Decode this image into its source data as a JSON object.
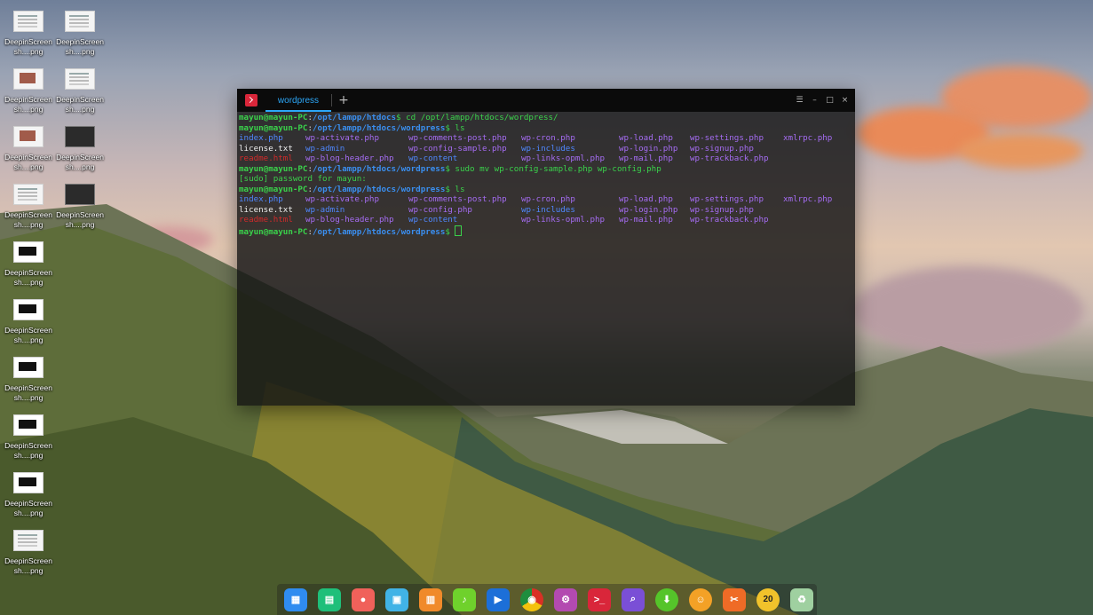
{
  "desktop": {
    "icons": [
      {
        "label": "DeepinScreensh....png",
        "thumb": "doc"
      },
      {
        "label": "DeepinScreensh....png",
        "thumb": "doc"
      },
      {
        "label": "DeepinScreensh....png",
        "thumb": "img"
      },
      {
        "label": "DeepinScreensh....png",
        "thumb": "doc"
      },
      {
        "label": "DeepinScreensh....png",
        "thumb": "img"
      },
      {
        "label": "DeepinScreensh....png",
        "thumb": "dark"
      },
      {
        "label": "DeepinScreensh....png",
        "thumb": "doc"
      },
      {
        "label": "DeepinScreensh....png",
        "thumb": "dark"
      },
      {
        "label": "DeepinScreensh....png",
        "thumb": "bw"
      },
      {
        "label": "DeepinScreensh....png",
        "thumb": "bw"
      },
      {
        "label": "DeepinScreensh....png",
        "thumb": "bw"
      },
      {
        "label": "DeepinScreensh....png",
        "thumb": "bw"
      },
      {
        "label": "DeepinScreensh....png",
        "thumb": "bw"
      },
      {
        "label": "DeepinScreensh....png",
        "thumb": "doc"
      }
    ]
  },
  "terminal": {
    "tab_label": "wordpress",
    "add_tab_icon": "plus-icon",
    "window_buttons": {
      "menu": "☰",
      "minimize": "–",
      "maximize": "□",
      "close": "×"
    },
    "lines": [
      {
        "user": "mayun@mayun-PC",
        "sep": ":",
        "path": "/opt/lampp/htdocs",
        "cmd": "$ cd /opt/lampp/htdocs/wordpress/"
      },
      {
        "user": "mayun@mayun-PC",
        "sep": ":",
        "path": "/opt/lampp/htdocs/wordpress",
        "cmd": "$ ls"
      },
      {
        "cols": [
          {
            "t": "index.php",
            "c": "bl"
          },
          {
            "t": "wp-activate.php",
            "c": "pu"
          },
          {
            "t": "wp-comments-post.php",
            "c": "pu"
          },
          {
            "t": "wp-cron.php",
            "c": "pu"
          },
          {
            "t": "wp-load.php",
            "c": "pu"
          },
          {
            "t": "wp-settings.php",
            "c": "pu"
          },
          {
            "t": "xmlrpc.php",
            "c": "pu"
          }
        ]
      },
      {
        "cols": [
          {
            "t": "license.txt",
            "c": "wh"
          },
          {
            "t": "wp-admin",
            "c": "bl"
          },
          {
            "t": "wp-config-sample.php",
            "c": "pu"
          },
          {
            "t": "wp-includes",
            "c": "bl"
          },
          {
            "t": "wp-login.php",
            "c": "pu"
          },
          {
            "t": "wp-signup.php",
            "c": "pu"
          },
          {
            "t": "",
            "c": "wh"
          }
        ]
      },
      {
        "cols": [
          {
            "t": "readme.html",
            "c": "rd"
          },
          {
            "t": "wp-blog-header.php",
            "c": "pu"
          },
          {
            "t": "wp-content",
            "c": "bl"
          },
          {
            "t": "wp-links-opml.php",
            "c": "pu"
          },
          {
            "t": "wp-mail.php",
            "c": "pu"
          },
          {
            "t": "wp-trackback.php",
            "c": "pu"
          },
          {
            "t": "",
            "c": "wh"
          }
        ]
      },
      {
        "user": "mayun@mayun-PC",
        "sep": ":",
        "path": "/opt/lampp/htdocs/wordpress",
        "cmd": "$ sudo mv wp-config-sample.php wp-config.php"
      },
      {
        "plain": "[sudo] password for mayun:"
      },
      {
        "user": "mayun@mayun-PC",
        "sep": ":",
        "path": "/opt/lampp/htdocs/wordpress",
        "cmd": "$ ls"
      },
      {
        "cols": [
          {
            "t": "index.php",
            "c": "bl"
          },
          {
            "t": "wp-activate.php",
            "c": "pu"
          },
          {
            "t": "wp-comments-post.php",
            "c": "pu"
          },
          {
            "t": "wp-cron.php",
            "c": "pu"
          },
          {
            "t": "wp-load.php",
            "c": "pu"
          },
          {
            "t": "wp-settings.php",
            "c": "pu"
          },
          {
            "t": "xmlrpc.php",
            "c": "pu"
          }
        ]
      },
      {
        "cols": [
          {
            "t": "license.txt",
            "c": "wh"
          },
          {
            "t": "wp-admin",
            "c": "bl"
          },
          {
            "t": "wp-config.php",
            "c": "pu"
          },
          {
            "t": "wp-includes",
            "c": "bl"
          },
          {
            "t": "wp-login.php",
            "c": "pu"
          },
          {
            "t": "wp-signup.php",
            "c": "pu"
          },
          {
            "t": "",
            "c": "wh"
          }
        ]
      },
      {
        "cols": [
          {
            "t": "readme.html",
            "c": "rd"
          },
          {
            "t": "wp-blog-header.php",
            "c": "pu"
          },
          {
            "t": "wp-content",
            "c": "bl"
          },
          {
            "t": "wp-links-opml.php",
            "c": "pu"
          },
          {
            "t": "wp-mail.php",
            "c": "pu"
          },
          {
            "t": "wp-trackback.php",
            "c": "pu"
          },
          {
            "t": "",
            "c": "wh"
          }
        ]
      },
      {
        "user": "mayun@mayun-PC",
        "sep": ":",
        "path": "/opt/lampp/htdocs/wordpress",
        "cmd": "$ ",
        "cursor": true
      }
    ]
  },
  "dock": {
    "items": [
      {
        "name": "launcher-icon",
        "glyph": "▦",
        "color": "#2f8cf0"
      },
      {
        "name": "multitasking-view-icon",
        "glyph": "▤",
        "color": "#1fbf7a"
      },
      {
        "name": "screen-recorder-icon",
        "glyph": "●",
        "color": "#f0615a"
      },
      {
        "name": "file-manager-icon",
        "glyph": "▣",
        "color": "#41b3e6"
      },
      {
        "name": "archive-manager-icon",
        "glyph": "▥",
        "color": "#f08a2a"
      },
      {
        "name": "music-icon",
        "glyph": "♪",
        "color": "#6fd12c"
      },
      {
        "name": "movie-icon",
        "glyph": "▶",
        "color": "#1c6fd8"
      },
      {
        "name": "chrome-icon",
        "glyph": "◉",
        "color": "#e8b11a"
      },
      {
        "name": "settings-icon",
        "glyph": "⚙",
        "color": "#b34ab0"
      },
      {
        "name": "terminal-icon",
        "glyph": ">_",
        "color": "#d9263a"
      },
      {
        "name": "system-monitor-icon",
        "glyph": "⌕",
        "color": "#7a4fd6"
      },
      {
        "name": "app-store-icon",
        "glyph": "⬇",
        "color": "#55c42a"
      },
      {
        "name": "chat-icon",
        "glyph": "☺",
        "color": "#f3a126"
      },
      {
        "name": "screenshot-tool-icon",
        "glyph": "✂",
        "color": "#ef6b26"
      },
      {
        "name": "calendar-icon",
        "glyph": "20",
        "color": "#f1c22b"
      },
      {
        "name": "trash-icon",
        "glyph": "♻",
        "color": "#9fd0a0"
      }
    ]
  }
}
